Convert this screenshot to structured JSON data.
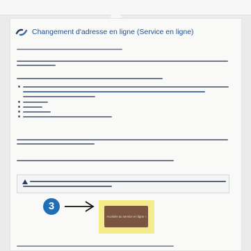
{
  "service": {
    "title": "Changement d'adresse en ligne (Service en ligne)"
  },
  "step": {
    "number": "3"
  },
  "access_button": {
    "label": "Accéder au service en ligne !"
  },
  "icons": {
    "header": "link-icon",
    "alert": "warning-icon",
    "arrow": "arrow-right-icon"
  },
  "colors": {
    "title": "#1f4f8c",
    "step_badge": "#1e6fb8",
    "button": "#7a5540",
    "highlight": "#f4ec8a"
  }
}
